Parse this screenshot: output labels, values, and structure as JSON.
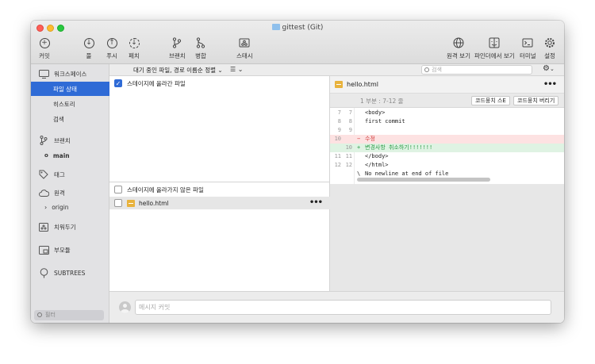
{
  "window": {
    "title": "gittest (Git)"
  },
  "toolbar": {
    "commit": "커밋",
    "pull": "풀",
    "push": "푸시",
    "fetch": "페치",
    "branch": "브랜치",
    "merge": "병합",
    "stash": "스태시",
    "remote_view": "원격 보기",
    "finder_view": "파인더에서 보기",
    "terminal": "터미널",
    "settings": "설정"
  },
  "sidebar": {
    "workspace": "워크스페이스",
    "file_status": "파일 상태",
    "history": "히스토리",
    "search": "검색",
    "branches": "브랜치",
    "current_branch": "main",
    "tags": "태그",
    "remotes": "원격",
    "remote_origin": "origin",
    "stashes": "치워두기",
    "submodules": "부모듈",
    "subtrees": "SUBTREES",
    "filter_placeholder": "필터"
  },
  "filebar": {
    "sort_label": "대기 중인 파일, 경로 이름순 정렬",
    "search_placeholder": "검색"
  },
  "staged": {
    "header": "스테이지에 올라간 파일",
    "checked": true
  },
  "unstaged": {
    "header": "스테이지에 올라가지 않은 파일",
    "files": [
      {
        "name": "hello.html"
      }
    ]
  },
  "diff": {
    "filename": "hello.html",
    "hunk_label": "1 부분 : 7-12 줄",
    "stage_hunk": "코드뭉치 스E",
    "discard_hunk": "코드뭉치 버리기",
    "lines": [
      {
        "old": "7",
        "new": "7",
        "sign": "",
        "text": "<body>",
        "type": "ctx"
      },
      {
        "old": "8",
        "new": "8",
        "sign": "",
        "text": "first commit",
        "type": "ctx"
      },
      {
        "old": "9",
        "new": "9",
        "sign": "",
        "text": "",
        "type": "ctx"
      },
      {
        "old": "10",
        "new": "",
        "sign": "−",
        "text": "수정",
        "type": "del"
      },
      {
        "old": "",
        "new": "10",
        "sign": "+",
        "text": "변경사항 취소하기!!!!!!!",
        "type": "add"
      },
      {
        "old": "11",
        "new": "11",
        "sign": "",
        "text": "</body>",
        "type": "ctx"
      },
      {
        "old": "12",
        "new": "12",
        "sign": "",
        "text": "</html>",
        "type": "ctx"
      },
      {
        "old": "",
        "new": "",
        "sign": "\\",
        "text": "No newline at end of file",
        "type": "ctx"
      }
    ]
  },
  "commit": {
    "placeholder": "메시지 커밋"
  },
  "colors": {
    "accent": "#2f6bd6",
    "deleted": "#fde2e2",
    "added": "#dff3e3",
    "file_icon": "#e8b23c"
  }
}
